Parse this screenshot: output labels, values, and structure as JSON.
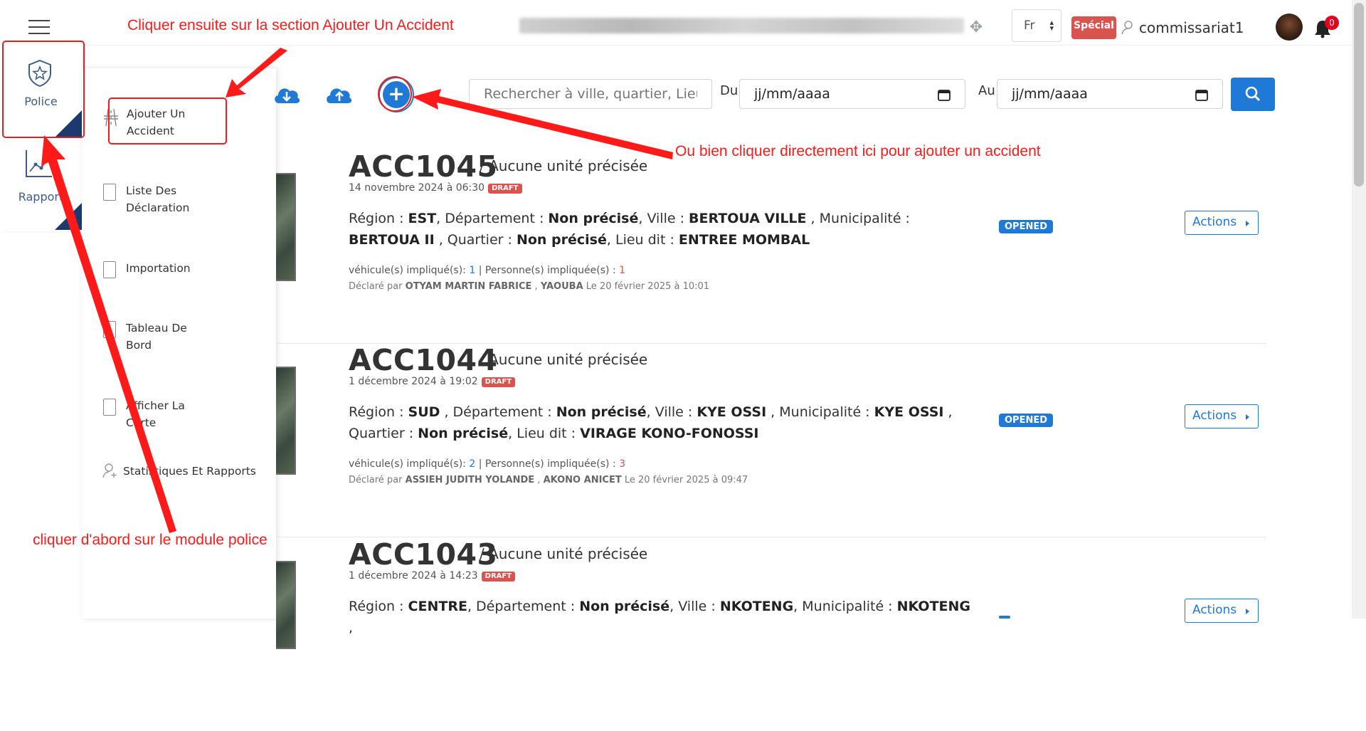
{
  "header": {
    "language": "Fr",
    "special_badge": "Spécial",
    "username": "commissariat1",
    "notification_count": "0"
  },
  "modules": [
    {
      "label": "Police"
    },
    {
      "label": "Rapport"
    }
  ],
  "submenu": [
    {
      "label": "Ajouter Un Accident"
    },
    {
      "label": "Liste Des Déclaration"
    },
    {
      "label": "Importation"
    },
    {
      "label": "Tableau De Bord"
    },
    {
      "label": "Afficher La Carte"
    },
    {
      "label": "Statistiques Et Rapports"
    }
  ],
  "toolbar": {
    "search_placeholder": "Rechercher à ville, quartier, Lieu...",
    "date_from_label": "Du",
    "date_to_label": "Au",
    "date_placeholder": "jj/mm/aaaa"
  },
  "accidents": [
    {
      "id": "ACC1045",
      "unit": "/ Aucune unité précisée",
      "date": "14 novembre 2024 à 06:30",
      "draft": "DRAFT",
      "labels": {
        "region": "Région :",
        "departement": "Département :",
        "ville": "Ville :",
        "municipalite": "Municipalité :",
        "quartier": "Quartier :",
        "lieu": "Lieu dit :"
      },
      "region": "EST",
      "departement": "Non précisé",
      "ville": "BERTOUA VILLE",
      "municipalite": "BERTOUA II",
      "quartier": "Non précisé",
      "lieu": "ENTREE MOMBAL",
      "vehicles_label": "véhicule(s) impliqué(s):",
      "vehicles": "1",
      "persons_label": "| Personne(s) impliquée(s) :",
      "persons": "1",
      "declared_prefix": "Déclaré par",
      "declared_by_1": "OTYAM MARTIN FABRICE",
      "declared_by_2": "YAOUBA",
      "declared_date": "Le 20 février 2025 à 10:01",
      "status": "OPENED",
      "actions": "Actions"
    },
    {
      "id": "ACC1044",
      "unit": "/ Aucune unité précisée",
      "date": "1 décembre 2024 à 19:02",
      "draft": "DRAFT",
      "labels": {
        "region": "Région :",
        "departement": "Département :",
        "ville": "Ville :",
        "municipalite": "Municipalité :",
        "quartier": "Quartier",
        "lieu": "Lieu dit :"
      },
      "region": "SUD",
      "departement": "Non précisé",
      "ville": "KYE OSSI",
      "municipalite": "KYE OSSI",
      "quartier": "Non précisé",
      "lieu": "VIRAGE KONO-FONOSSI",
      "vehicles_label": "véhicule(s) impliqué(s):",
      "vehicles": "2",
      "persons_label": "| Personne(s) impliquée(s) :",
      "persons": "3",
      "declared_prefix": "Déclaré par",
      "declared_by_1": "ASSIEH JUDITH YOLANDE",
      "declared_by_2": "AKONO ANICET",
      "declared_date": "Le 20 février 2025 à 09:47",
      "status": "OPENED",
      "actions": "Actions"
    },
    {
      "id": "ACC1043",
      "unit": "/ Aucune unité précisée",
      "date": "1 décembre 2024 à 14:23",
      "draft": "DRAFT",
      "labels": {
        "region": "Région :",
        "departement": "Département :",
        "ville": "Ville :",
        "municipalite": "Municipalité :"
      },
      "region": "CENTRE",
      "departement": "Non précisé",
      "ville": "NKOTENG",
      "municipalite": "NKOTENG",
      "actions": "Actions"
    }
  ],
  "annotations": {
    "step2": "Cliquer ensuite sur la section Ajouter Un Accident",
    "alt": "Ou bien cliquer directement ici pour ajouter un accident",
    "step1": "cliquer d'abord sur le module police"
  },
  "colors": {
    "primary": "#1e7ad6",
    "danger": "#d9534f",
    "annotation": "#ff1a1a",
    "module_corner": "#1d3a6e"
  }
}
